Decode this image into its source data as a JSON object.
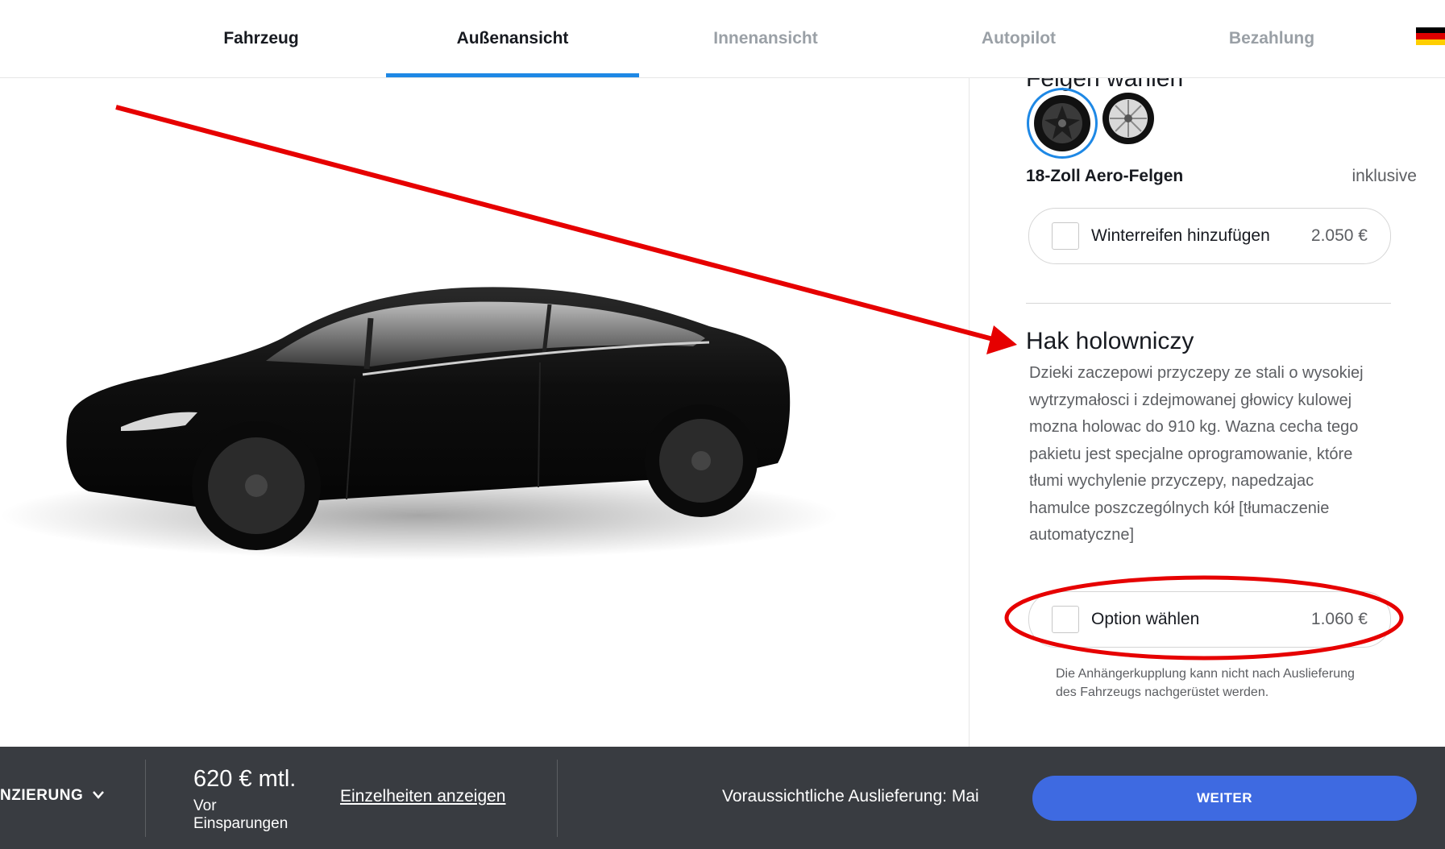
{
  "nav": {
    "tabs": [
      {
        "label": "Fahrzeug"
      },
      {
        "label": "Außenansicht"
      },
      {
        "label": "Innenansicht"
      },
      {
        "label": "Autopilot"
      },
      {
        "label": "Bezahlung"
      }
    ],
    "active_tab": "Außenansicht",
    "language_flag": "germany-flag-icon"
  },
  "wheels": {
    "section_title": "Felgen wählen",
    "selected_name": "18-Zoll Aero-Felgen",
    "selected_price": "inklusive",
    "winter_tires": {
      "label": "Winterreifen hinzufügen",
      "price": "2.050 €"
    }
  },
  "tow_hitch": {
    "title": "Hak holowniczy",
    "description": "Dzieki zaczepowi przyczepy ze stali o wysokiej wytrzymałosci i zdejmowanej głowicy kulowej mozna holowac do 910 kg. Wazna cecha tego pakietu jest specjalne oprogramowanie, które tłumi wychylenie przyczepy, napedzajac hamulce poszczególnych kół [tłumaczenie automatyczne]",
    "option": {
      "label": "Option wählen",
      "price": "1.060 €"
    },
    "note": "Die Anhängerkupplung kann nicht nach Auslieferung des Fahrzeugs nachgerüstet werden."
  },
  "footer": {
    "financing_label": "NZIERUNG",
    "monthly_price": "620 € mtl.",
    "savings_label": "Vor Einsparungen",
    "details_link": "Einzelheiten anzeigen",
    "delivery": "Voraussichtliche Auslieferung: Mai",
    "continue_button": "WEITER"
  },
  "colors": {
    "accent_blue": "#3e6ae1",
    "tab_underline": "#1e88e5",
    "bottom_bar": "#393c41",
    "annotation_red": "#e60000"
  }
}
